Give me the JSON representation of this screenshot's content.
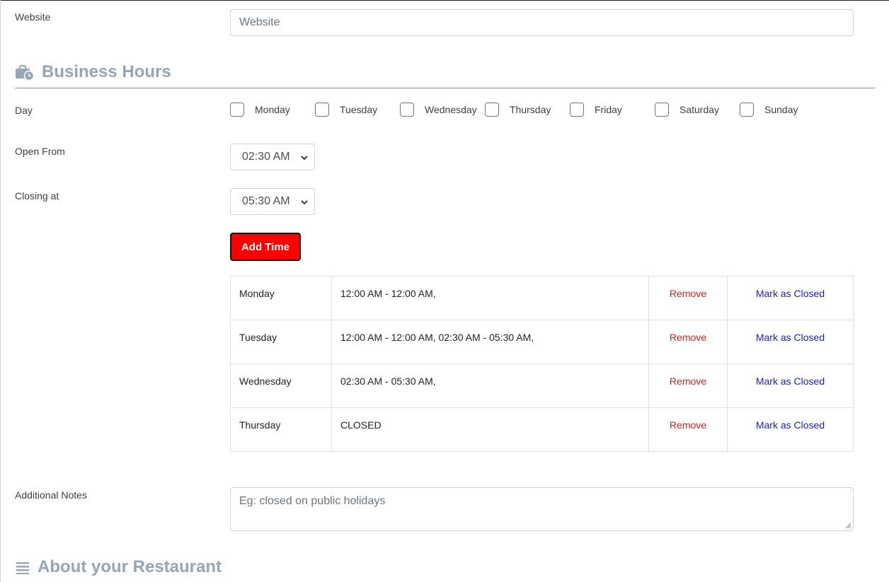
{
  "website": {
    "label": "Website",
    "placeholder": "Website"
  },
  "business_hours": {
    "title": "Business Hours",
    "icon": "briefcase-clock-icon",
    "day_label": "Day",
    "days": [
      "Monday",
      "Tuesday",
      "Wednesday",
      "Thursday",
      "Friday",
      "Saturday",
      "Sunday"
    ],
    "open_from_label": "Open From",
    "open_from_value": "02:30 AM",
    "closing_at_label": "Closing at",
    "closing_at_value": "05:30 AM",
    "add_button": "Add Time",
    "rows": [
      {
        "day": "Monday",
        "time": "12:00 AM - 12:00 AM,",
        "remove": "Remove",
        "mark": "Mark as Closed"
      },
      {
        "day": "Tuesday",
        "time": "12:00 AM - 12:00 AM, 02:30 AM - 05:30 AM,",
        "remove": "Remove",
        "mark": "Mark as Closed"
      },
      {
        "day": "Wednesday",
        "time": "02:30 AM - 05:30 AM,",
        "remove": "Remove",
        "mark": "Mark as Closed"
      },
      {
        "day": "Thursday",
        "time": "CLOSED",
        "remove": "Remove",
        "mark": "Mark as Closed"
      }
    ]
  },
  "notes": {
    "label": "Additional Notes",
    "placeholder": "Eg: closed on public holidays"
  },
  "about": {
    "title": "About your Restaurant",
    "icon": "list-icon"
  },
  "colors": {
    "add_button": "#ff0000",
    "remove_link": "#e31b1b",
    "mark_link": "#1a1ad1",
    "section_title": "#98a5b7"
  }
}
